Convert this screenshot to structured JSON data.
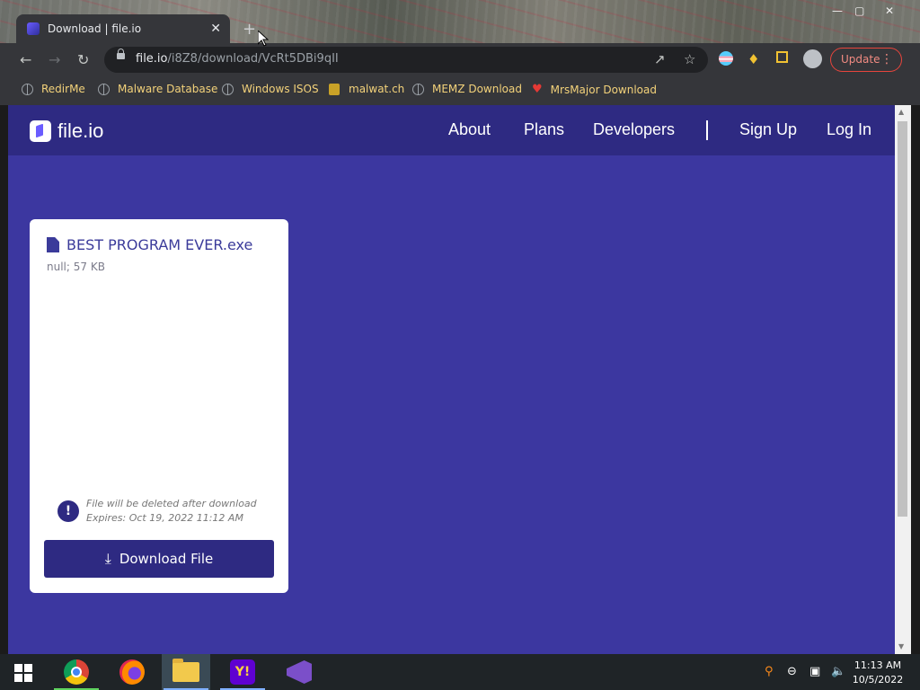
{
  "browser": {
    "tab_title": "Download | file.io",
    "tab_close": "✕",
    "new_tab": "+",
    "window_controls": {
      "minimize": "—",
      "maximize": "▢",
      "close": "✕"
    },
    "url_domain": "file.io",
    "url_path": "/i8Z8/download/VcRt5DBi9qII",
    "update_label": "Update",
    "bookmarks": [
      {
        "label": "RedirMe",
        "icon": "globe-icon"
      },
      {
        "label": "Malware Database",
        "icon": "globe-icon"
      },
      {
        "label": "Windows ISOS",
        "icon": "globe-icon"
      },
      {
        "label": "malwat.ch",
        "icon": "malwat-icon"
      },
      {
        "label": "MEMZ Download",
        "icon": "globe-icon"
      },
      {
        "label": "MrsMajor Download",
        "icon": "heart-icon"
      }
    ]
  },
  "site": {
    "logo_text": "file.io",
    "nav": {
      "about": "About",
      "plans": "Plans",
      "developers": "Developers",
      "signup": "Sign Up",
      "login": "Log In"
    },
    "colors": {
      "background": "#3c37a0",
      "nav": "#2e2a82",
      "card": "#ffffff",
      "button": "#2e2a82"
    }
  },
  "file": {
    "name": "BEST PROGRAM EVER.exe",
    "meta": "null; 57 KB",
    "note_deleted": "File will be deleted after download",
    "note_expires": "Expires: Oct 19, 2022 11:12 AM",
    "info_glyph": "!",
    "download_label": "Download File"
  },
  "taskbar": {
    "apps": [
      "chrome-icon",
      "firefox-icon",
      "file-explorer-icon",
      "yahoo-messenger-icon",
      "visual-studio-icon"
    ],
    "time": "11:13 AM",
    "date": "10/5/2022"
  }
}
